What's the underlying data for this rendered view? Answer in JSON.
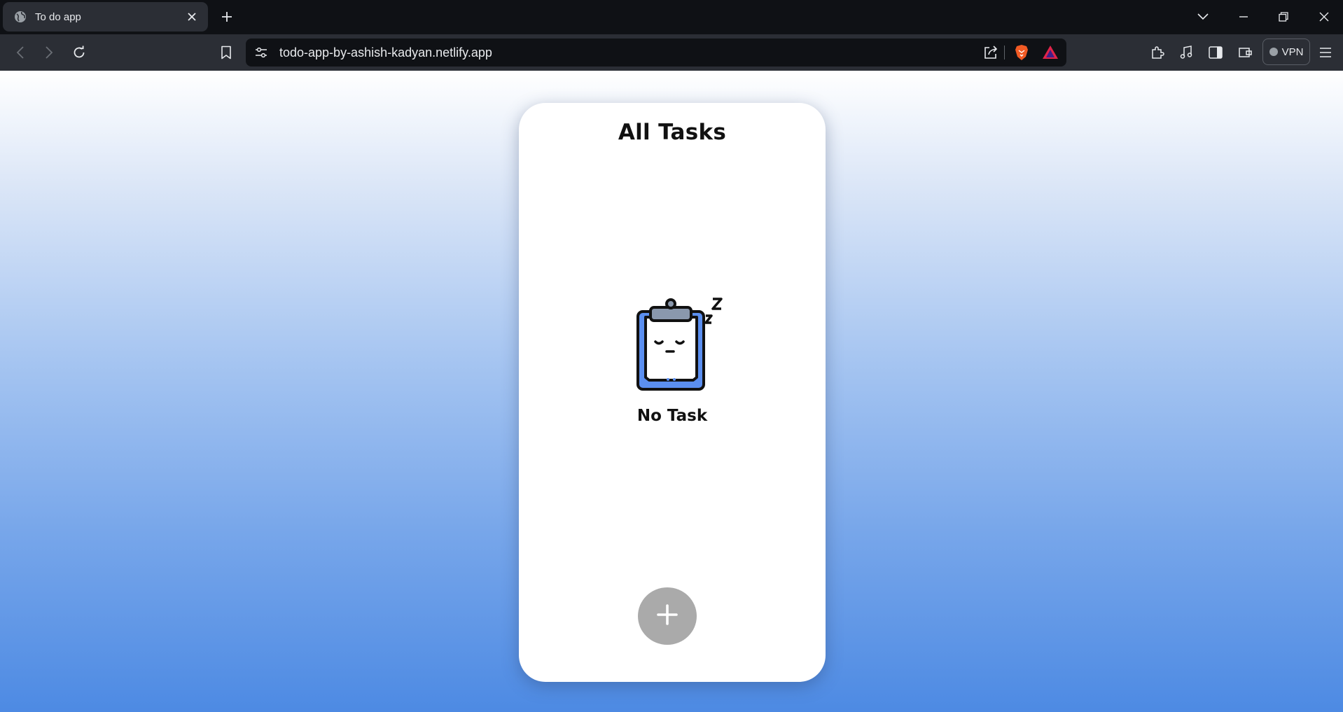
{
  "browser": {
    "tab": {
      "title": "To do app",
      "favicon": "globe-icon"
    },
    "address": {
      "url": "todo-app-by-ashish-kadyan.netlify.app"
    },
    "vpn_label": "VPN"
  },
  "app": {
    "title": "All Tasks",
    "empty_state": {
      "illustration": "sleeping-clipboard-icon",
      "text": "No Task"
    },
    "add_button": {
      "icon": "plus-icon",
      "color": "#aaaaaa"
    }
  },
  "colors": {
    "gradient_top": "#ffffff",
    "gradient_bottom": "#4d8ae3",
    "card": "#ffffff",
    "clipboard_blue": "#5b8ff0"
  }
}
